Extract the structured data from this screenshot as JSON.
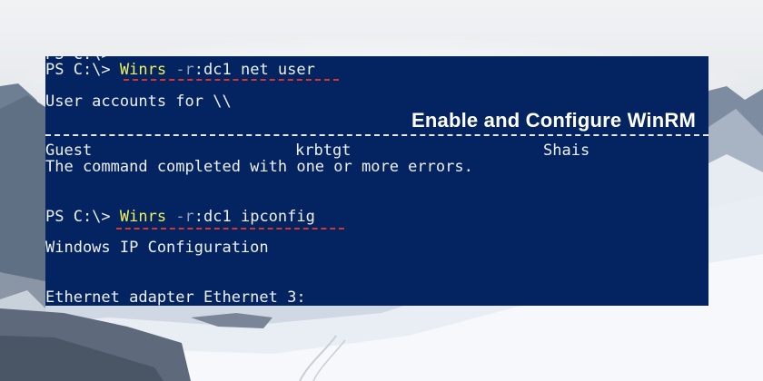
{
  "terminal": {
    "clipped_line": "PS C:\\>",
    "cmd1": {
      "prompt": "PS C:\\> ",
      "exe": "Winrs",
      "flag": " -r",
      "rest": ":dc1 net user"
    },
    "line_user_accounts": "User accounts for \\\\",
    "accounts": [
      "Guest",
      "krbtgt",
      "Shais"
    ],
    "line_error": "The command completed with one or more errors.",
    "cmd2": {
      "prompt": "PS C:\\> ",
      "exe": "Winrs",
      "flag": " -r",
      "rest": ":dc1 ipconfig"
    },
    "line_winip": "Windows IP Configuration",
    "line_ethernet": "Ethernet adapter Ethernet 3:"
  },
  "caption": "Enable and Configure WinRM",
  "colors": {
    "terminal_bg": "#032460",
    "command_exe": "#f3ef5b",
    "flag": "#9aa4b8",
    "underline": "#d9362b"
  }
}
